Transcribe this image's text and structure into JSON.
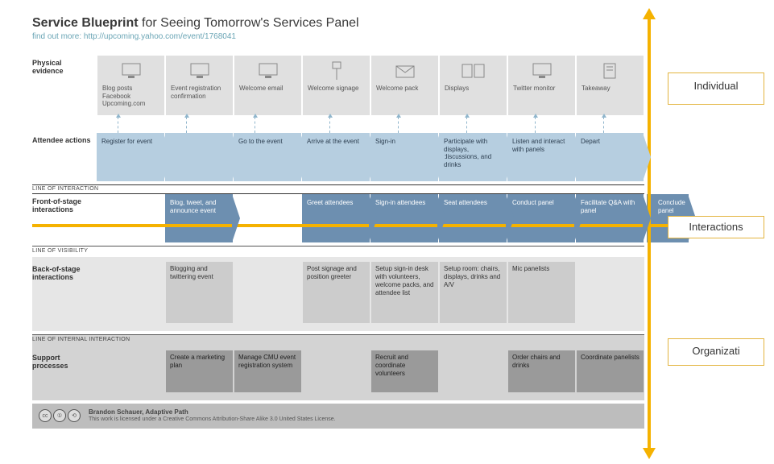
{
  "header": {
    "title_bold": "Service Blueprint",
    "title_rest": " for Seeing Tomorrow's Services Panel",
    "subtitle_text": "find out more: ",
    "subtitle_link": "http://upcoming.yahoo.com/event/1768041"
  },
  "lanes": {
    "physical": "Physical evidence",
    "attendee": "Attendee actions",
    "front": "Front-of-stage interactions",
    "back": "Back-of-stage interactions",
    "support": "Support processes"
  },
  "lines": {
    "interaction": "LINE OF INTERACTION",
    "visibility": "LINE OF VISIBILITY",
    "internal": "LINE OF INTERNAL INTERACTION"
  },
  "physical_evidence": [
    {
      "label": "Blog posts\nFacebook\nUpcoming.com",
      "icon": "monitor"
    },
    {
      "label": "Event registration confirmation",
      "icon": "monitor"
    },
    {
      "label": "Welcome email",
      "icon": "monitor"
    },
    {
      "label": "Welcome signage",
      "icon": "sign"
    },
    {
      "label": "Welcome pack",
      "icon": "envelope"
    },
    {
      "label": "Displays",
      "icon": "displays"
    },
    {
      "label": "Twitter monitor",
      "icon": "monitor"
    },
    {
      "label": "Takeaway",
      "icon": "doc"
    }
  ],
  "attendee_actions": [
    "Register for event",
    "",
    "Go to the event",
    "Arrive at the event",
    "Sign-in",
    "Participate with displays, discussions, and drinks",
    "Listen and interact with panels",
    "Depart"
  ],
  "front_stage": [
    "",
    "Blog, tweet, and announce event",
    "",
    "Greet attendees",
    "Sign-in attendees",
    "Seat attendees",
    "Conduct panel",
    "Facilitate Q&A with panel"
  ],
  "front_stage_trailing": "Conclude panel",
  "back_stage": [
    "",
    "Blogging and twittering event",
    "",
    "Post signage and position greeter",
    "Setup sign-in desk with volunteers, welcome packs, and attendee list",
    "Setup room: chairs, displays, drinks and A/V",
    "Mic panelists",
    ""
  ],
  "support": [
    "",
    "Create a marketing plan",
    "Manage CMU event registration system",
    "",
    "Recruit and coordinate volunteers",
    "",
    "Order chairs and drinks",
    "Coordinate panelists"
  ],
  "footer": {
    "author": "Brandon Schauer, Adaptive Path",
    "license": "This work is licensed under a Creative Commons Attribution-Share Alike 3.0 United States License."
  },
  "annotations": {
    "top": "Individual",
    "mid": "Interactions",
    "bottom": "Organizati"
  }
}
